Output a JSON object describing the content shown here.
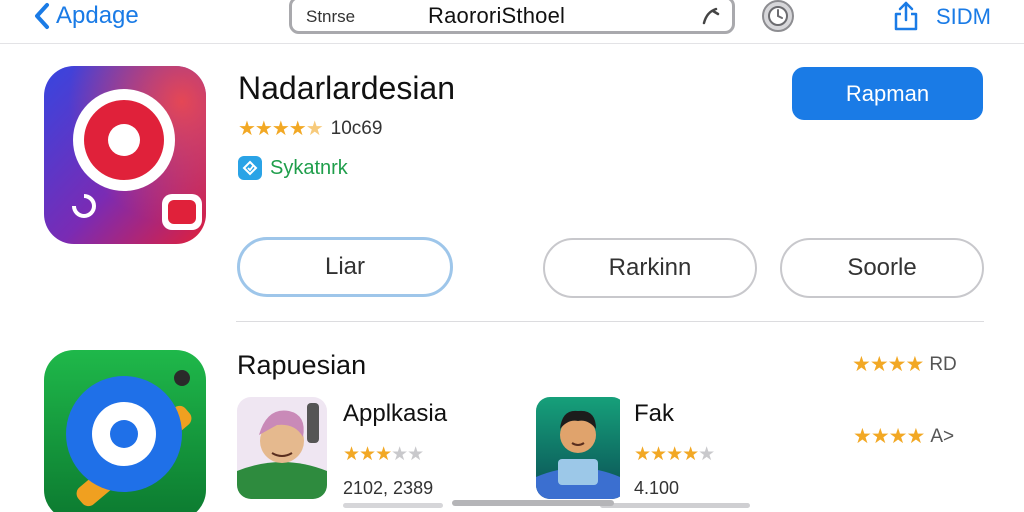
{
  "header": {
    "back_label": "Apdage",
    "search_prefix": "Stnrse",
    "search_value": "RaororiSthoel",
    "signin_label": "SIDM"
  },
  "app": {
    "title": "Nadarlardesian",
    "stars": "★★★★",
    "star_half": "★",
    "rating_count": "10c69",
    "developer": "Sykatnrk",
    "primary_button": "Rapman",
    "icon": "record-app-icon"
  },
  "tabs": [
    {
      "label": "Liar",
      "active": true
    },
    {
      "label": "Rarkinn",
      "active": false
    },
    {
      "label": "Soorle",
      "active": false
    }
  ],
  "section": {
    "title": "Rapuesian",
    "rating_row_1": {
      "stars": "★★★★",
      "tail": "RD"
    },
    "rating_row_2": {
      "stars": "★★★★",
      "tail": "A>"
    },
    "icon": "target-app-icon"
  },
  "mini_apps": [
    {
      "name": "Applkasia",
      "stars": "★★★",
      "stars_off": "★★",
      "count": "2102, 2389"
    },
    {
      "name": "Fak",
      "stars": "★★★★",
      "stars_off": "★",
      "count": "4.100"
    }
  ],
  "colors": {
    "accent": "#1a7be6",
    "star": "#f2a824",
    "developer": "#1f9e4b"
  }
}
